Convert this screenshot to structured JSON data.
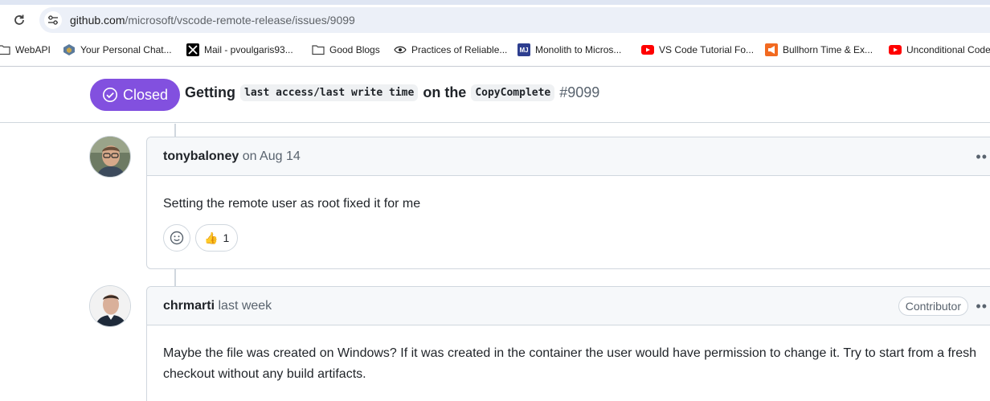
{
  "browser": {
    "url_host": "github.com",
    "url_path": "/microsoft/vscode-remote-release/issues/9099",
    "bookmarks": [
      {
        "label": "WebAPI",
        "icon": "folder-icon"
      },
      {
        "label": "Your Personal Chat...",
        "icon": "chat-icon"
      },
      {
        "label": "Mail - pvoulgaris93...",
        "icon": "x-icon"
      },
      {
        "label": "Good Blogs",
        "icon": "folder-icon"
      },
      {
        "label": "Practices of Reliable...",
        "icon": "eye-icon"
      },
      {
        "label": "Monolith to Micros...",
        "icon": "mj-icon"
      },
      {
        "label": "VS Code Tutorial Fo...",
        "icon": "youtube-icon"
      },
      {
        "label": "Bullhorn Time & Ex...",
        "icon": "bullhorn-icon"
      },
      {
        "label": "Unconditional Code",
        "icon": "youtube-icon"
      }
    ]
  },
  "issue": {
    "state": "Closed",
    "title_parts": {
      "t1": "Getting",
      "code1": "last access/last write time",
      "t2": "on the",
      "code2": "CopyComplete",
      "number": "#9099"
    },
    "state_color": "#8250df"
  },
  "comments": [
    {
      "author": "tonybaloney",
      "when": "on Aug 14",
      "body": "Setting the remote user as root fixed it for me",
      "reactions": [
        {
          "emoji": "👍",
          "count": "1"
        }
      ]
    },
    {
      "author": "chrmarti",
      "when": "last week",
      "role": "Contributor",
      "body": "Maybe the file was created on Windows? If it was created in the container the user would have permission to change it. Try to start from a fresh checkout without any build artifacts."
    }
  ]
}
